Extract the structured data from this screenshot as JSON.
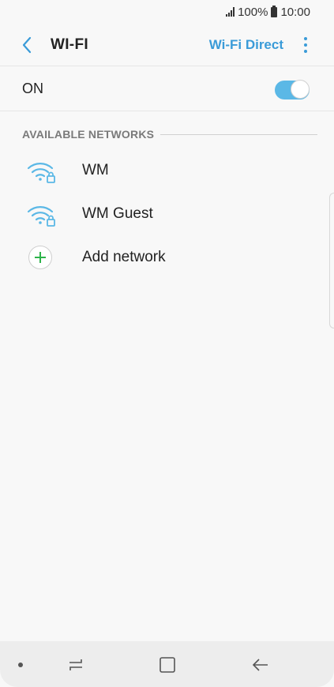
{
  "status_bar": {
    "battery": "100%",
    "time": "10:00"
  },
  "header": {
    "title": "WI-FI",
    "wifi_direct": "Wi-Fi Direct",
    "back_icon": "chevron-left-icon",
    "more_icon": "more-vertical-icon"
  },
  "master_switch": {
    "label": "ON",
    "state": true
  },
  "networks_section": {
    "title": "AVAILABLE NETWORKS",
    "items": [
      {
        "label": "WM",
        "icon": "wifi-lock-icon"
      },
      {
        "label": "WM Guest",
        "icon": "wifi-lock-icon"
      }
    ],
    "add_label": "Add network"
  },
  "colors": {
    "accent": "#3a9bd8",
    "toggle_on": "#5bb8e6",
    "add_green": "#2db34a",
    "wifi_icon": "#5bb8e6"
  }
}
